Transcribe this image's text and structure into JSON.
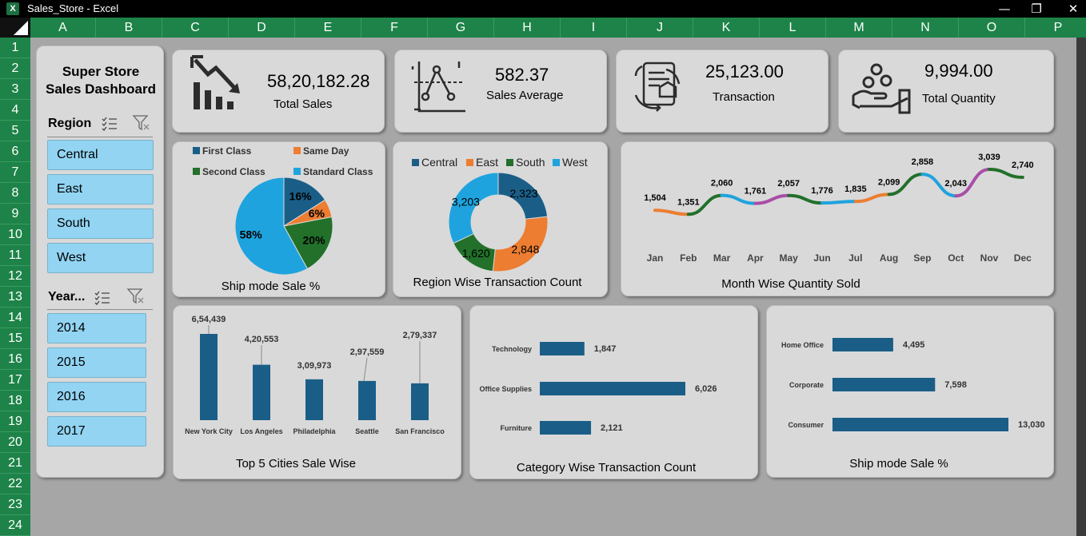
{
  "window": {
    "title": "Sales_Store - Excel",
    "app_icon": "X"
  },
  "columns": [
    "A",
    "B",
    "C",
    "D",
    "E",
    "F",
    "G",
    "H",
    "I",
    "J",
    "K",
    "L",
    "M",
    "N",
    "O",
    "P"
  ],
  "rows": [
    "1",
    "2",
    "3",
    "4",
    "5",
    "6",
    "7",
    "8",
    "9",
    "10",
    "11",
    "12",
    "13",
    "14",
    "15",
    "16",
    "17",
    "18",
    "19",
    "20",
    "21",
    "22",
    "23",
    "24"
  ],
  "dashboard": {
    "title_line1": "Super Store",
    "title_line2": "Sales Dashboard"
  },
  "region_slicer": {
    "header": "Region",
    "items": [
      "Central",
      "East",
      "South",
      "West"
    ]
  },
  "year_slicer": {
    "header": "Year...",
    "items": [
      "2014",
      "2015",
      "2016",
      "2017"
    ]
  },
  "kpis": {
    "total_sales": {
      "value": "58,20,182.28",
      "label": "Total Sales",
      "icon": "declining-chart-icon"
    },
    "sales_average": {
      "value": "582.37",
      "label": "Sales Average",
      "icon": "average-graph-icon"
    },
    "transaction": {
      "value": "25,123.00",
      "label": "Transaction",
      "icon": "transaction-document-icon"
    },
    "total_quantity": {
      "value": "9,994.00",
      "label": "Total Quantity",
      "icon": "hand-coins-icon"
    }
  },
  "colors": {
    "dark_blue": "#1a5e87",
    "orange": "#ed7d31",
    "green": "#22702a",
    "light_blue": "#1fa3de",
    "purple": "#a84ea8",
    "bar": "#1a5e87",
    "excel_green": "#1d8348"
  },
  "chart_data": [
    {
      "type": "pie",
      "title": "Ship mode Sale %",
      "labels": [
        "First Class",
        "Same Day",
        "Second Class",
        "Standard Class"
      ],
      "values": [
        16,
        6,
        20,
        58
      ],
      "data_labels": [
        "16%",
        "6%",
        "20%",
        "58%"
      ]
    },
    {
      "type": "pie",
      "subtype": "doughnut",
      "title": "Region Wise Transaction Count",
      "labels": [
        "Central",
        "East",
        "South",
        "West"
      ],
      "values": [
        2323,
        2848,
        1620,
        3203
      ],
      "data_labels": [
        "2,323",
        "2,848",
        "1,620",
        "3,203"
      ]
    },
    {
      "type": "line",
      "title": "Month Wise Quantity Sold",
      "categories": [
        "Jan",
        "Feb",
        "Mar",
        "Apr",
        "May",
        "Jun",
        "Jul",
        "Aug",
        "Sep",
        "Oct",
        "Nov",
        "Dec"
      ],
      "values": [
        1504,
        1351,
        2060,
        1761,
        2057,
        1776,
        1835,
        2099,
        2858,
        2043,
        3039,
        2740
      ],
      "data_labels": [
        "1,504",
        "1,351",
        "2,060",
        "1,761",
        "2,057",
        "1,776",
        "1,835",
        "2,099",
        "2,858",
        "2,043",
        "3,039",
        "2,740"
      ]
    },
    {
      "type": "bar",
      "title": "Top 5 Cities Sale Wise",
      "categories": [
        "New York City",
        "Los Angeles",
        "Philadelphia",
        "Seattle",
        "San Francisco"
      ],
      "values": [
        654439,
        420553,
        309973,
        297559,
        279337
      ],
      "data_labels": [
        "6,54,439",
        "4,20,553",
        "3,09,973",
        "2,97,559",
        "2,79,337"
      ]
    },
    {
      "type": "bar",
      "orientation": "horizontal",
      "title": "Category Wise Transaction Count",
      "categories": [
        "Technology",
        "Office Supplies",
        "Furniture"
      ],
      "values": [
        1847,
        6026,
        2121
      ],
      "data_labels": [
        "1,847",
        "6,026",
        "2,121"
      ]
    },
    {
      "type": "bar",
      "orientation": "horizontal",
      "title": "Ship mode Sale %",
      "categories": [
        "Home Office",
        "Corporate",
        "Consumer"
      ],
      "values": [
        4495,
        7598,
        13030
      ],
      "data_labels": [
        "4,495",
        "7,598",
        "13,030"
      ]
    }
  ]
}
